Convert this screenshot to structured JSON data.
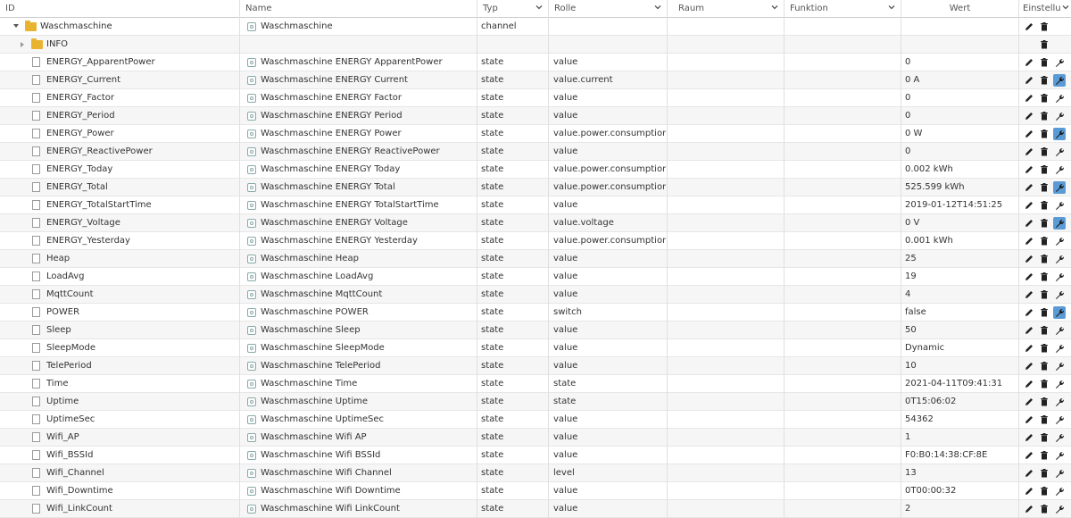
{
  "header": {
    "id": "ID",
    "name": "Name",
    "type": "Typ",
    "role": "Rolle",
    "room": "Raum",
    "function": "Funktion",
    "value": "Wert",
    "settings": "Einstellu"
  },
  "rows": [
    {
      "id": "Waschmaschine",
      "name": "Waschmaschine",
      "type": "channel",
      "role": "",
      "value": "",
      "kind": "channel",
      "wrench": false
    },
    {
      "id": "INFO",
      "name": "",
      "type": "",
      "role": "",
      "value": "",
      "kind": "folder",
      "wrench": false
    },
    {
      "id": "ENERGY_ApparentPower",
      "name": "Waschmaschine ENERGY ApparentPower",
      "type": "state",
      "role": "value",
      "value": "0",
      "kind": "state",
      "wrench": false
    },
    {
      "id": "ENERGY_Current",
      "name": "Waschmaschine ENERGY Current",
      "type": "state",
      "role": "value.current",
      "value": "0 A",
      "kind": "state",
      "wrench": true
    },
    {
      "id": "ENERGY_Factor",
      "name": "Waschmaschine ENERGY Factor",
      "type": "state",
      "role": "value",
      "value": "0",
      "kind": "state",
      "wrench": false
    },
    {
      "id": "ENERGY_Period",
      "name": "Waschmaschine ENERGY Period",
      "type": "state",
      "role": "value",
      "value": "0",
      "kind": "state",
      "wrench": false
    },
    {
      "id": "ENERGY_Power",
      "name": "Waschmaschine ENERGY Power",
      "type": "state",
      "role": "value.power.consumption",
      "value": "0 W",
      "kind": "state",
      "wrench": true
    },
    {
      "id": "ENERGY_ReactivePower",
      "name": "Waschmaschine ENERGY ReactivePower",
      "type": "state",
      "role": "value",
      "value": "0",
      "kind": "state",
      "wrench": false
    },
    {
      "id": "ENERGY_Today",
      "name": "Waschmaschine ENERGY Today",
      "type": "state",
      "role": "value.power.consumption",
      "value": "0.002 kWh",
      "kind": "state",
      "wrench": false
    },
    {
      "id": "ENERGY_Total",
      "name": "Waschmaschine ENERGY Total",
      "type": "state",
      "role": "value.power.consumption",
      "value": "525.599 kWh",
      "kind": "state",
      "wrench": true
    },
    {
      "id": "ENERGY_TotalStartTime",
      "name": "Waschmaschine ENERGY TotalStartTime",
      "type": "state",
      "role": "value",
      "value": "2019-01-12T14:51:25",
      "kind": "state",
      "wrench": false
    },
    {
      "id": "ENERGY_Voltage",
      "name": "Waschmaschine ENERGY Voltage",
      "type": "state",
      "role": "value.voltage",
      "value": "0 V",
      "kind": "state",
      "wrench": true
    },
    {
      "id": "ENERGY_Yesterday",
      "name": "Waschmaschine ENERGY Yesterday",
      "type": "state",
      "role": "value.power.consumption",
      "value": "0.001 kWh",
      "kind": "state",
      "wrench": false
    },
    {
      "id": "Heap",
      "name": "Waschmaschine Heap",
      "type": "state",
      "role": "value",
      "value": "25",
      "kind": "state",
      "wrench": false
    },
    {
      "id": "LoadAvg",
      "name": "Waschmaschine LoadAvg",
      "type": "state",
      "role": "value",
      "value": "19",
      "kind": "state",
      "wrench": false
    },
    {
      "id": "MqttCount",
      "name": "Waschmaschine MqttCount",
      "type": "state",
      "role": "value",
      "value": "4",
      "kind": "state",
      "wrench": false
    },
    {
      "id": "POWER",
      "name": "Waschmaschine POWER",
      "type": "state",
      "role": "switch",
      "value": "false",
      "kind": "state",
      "wrench": true
    },
    {
      "id": "Sleep",
      "name": "Waschmaschine Sleep",
      "type": "state",
      "role": "value",
      "value": "50",
      "kind": "state",
      "wrench": false
    },
    {
      "id": "SleepMode",
      "name": "Waschmaschine SleepMode",
      "type": "state",
      "role": "value",
      "value": "Dynamic",
      "kind": "state",
      "wrench": false
    },
    {
      "id": "TelePeriod",
      "name": "Waschmaschine TelePeriod",
      "type": "state",
      "role": "value",
      "value": "10",
      "kind": "state",
      "wrench": false
    },
    {
      "id": "Time",
      "name": "Waschmaschine Time",
      "type": "state",
      "role": "state",
      "value": "2021-04-11T09:41:31",
      "kind": "state",
      "wrench": false
    },
    {
      "id": "Uptime",
      "name": "Waschmaschine Uptime",
      "type": "state",
      "role": "state",
      "value": "0T15:06:02",
      "kind": "state",
      "wrench": false
    },
    {
      "id": "UptimeSec",
      "name": "Waschmaschine UptimeSec",
      "type": "state",
      "role": "value",
      "value": "54362",
      "kind": "state",
      "wrench": false
    },
    {
      "id": "Wifi_AP",
      "name": "Waschmaschine Wifi AP",
      "type": "state",
      "role": "value",
      "value": "1",
      "kind": "state",
      "wrench": false
    },
    {
      "id": "Wifi_BSSId",
      "name": "Waschmaschine Wifi BSSId",
      "type": "state",
      "role": "value",
      "value": "F0:B0:14:38:CF:8E",
      "kind": "state",
      "wrench": false
    },
    {
      "id": "Wifi_Channel",
      "name": "Waschmaschine Wifi Channel",
      "type": "state",
      "role": "level",
      "value": "13",
      "kind": "state",
      "wrench": false
    },
    {
      "id": "Wifi_Downtime",
      "name": "Waschmaschine Wifi Downtime",
      "type": "state",
      "role": "value",
      "value": "0T00:00:32",
      "kind": "state",
      "wrench": false
    },
    {
      "id": "Wifi_LinkCount",
      "name": "Waschmaschine Wifi LinkCount",
      "type": "state",
      "role": "value",
      "value": "2",
      "kind": "state",
      "wrench": false
    }
  ],
  "colors": {
    "wrench_active": "#5b9bd5",
    "folder": "#e8b430"
  },
  "icons": {
    "edit": "pencil-icon",
    "delete": "trash-icon",
    "custom": "wrench-icon",
    "expand": "triangle-icon",
    "folder": "folder-icon",
    "state": "file-icon"
  }
}
